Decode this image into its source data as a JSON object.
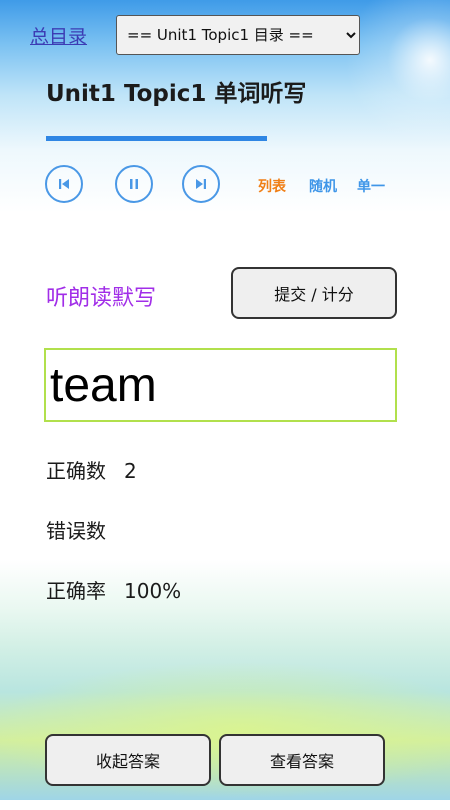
{
  "header": {
    "toc_link": "总目录",
    "toc_select_value": "== Unit1 Topic1 目录 ==",
    "title": "Unit1 Topic1 单词听写"
  },
  "progress": {
    "fraction": 0.63
  },
  "player": {
    "prev_icon": "skip-previous-icon",
    "pause_icon": "pause-icon",
    "next_icon": "skip-next-icon",
    "modes": [
      {
        "label": "列表",
        "color": "#f07f16"
      },
      {
        "label": "随机",
        "color": "#3f96e8"
      },
      {
        "label": "单一",
        "color": "#3f96e8"
      }
    ]
  },
  "dictation": {
    "mode_label": "听朗读默写",
    "submit_label": "提交 / 计分",
    "answer_value": "team"
  },
  "stats": {
    "correct_label": "正确数",
    "correct_value": "2",
    "wrong_label": "错误数",
    "wrong_value": "",
    "rate_label": "正确率",
    "rate_value": "100%"
  },
  "footer": {
    "hide_answer_label": "收起答案",
    "show_answer_label": "查看答案"
  },
  "colors": {
    "accent": "#2f86e4",
    "mode_label": "#a12ee8",
    "input_border": "#b1e04c"
  }
}
